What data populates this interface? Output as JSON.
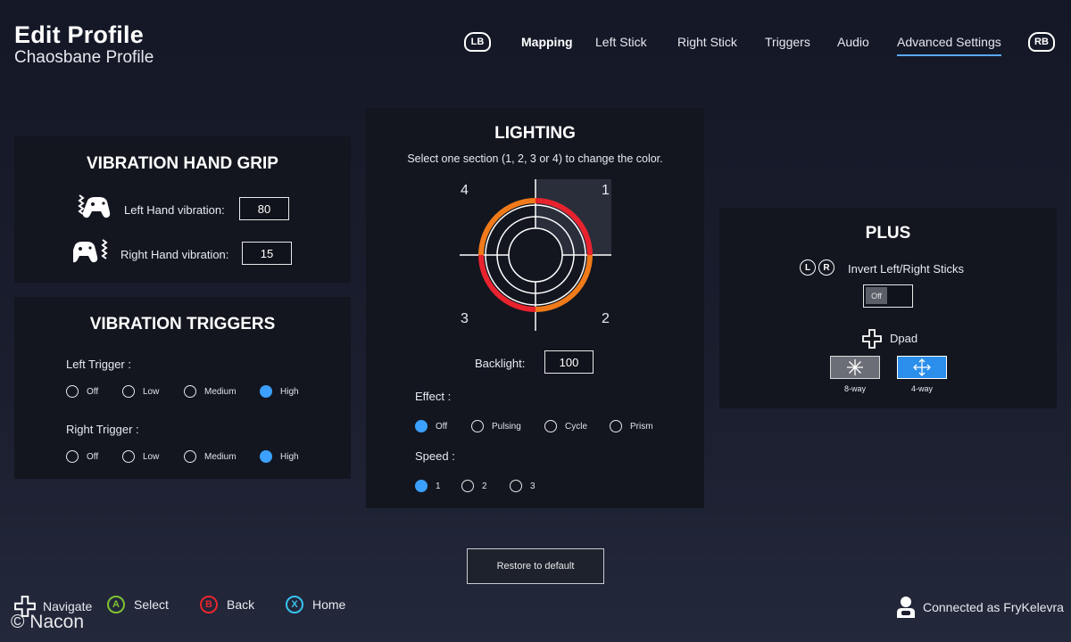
{
  "header": {
    "title": "Edit Profile",
    "subtitle": "Chaosbane Profile"
  },
  "nav": {
    "lb": "LB",
    "rb": "RB",
    "tabs": [
      "Mapping",
      "Left Stick",
      "Right Stick",
      "Triggers",
      "Audio",
      "Advanced Settings"
    ],
    "active_tab": "Advanced Settings"
  },
  "vibration_grip": {
    "title": "VIBRATION HAND GRIP",
    "left_label": "Left Hand vibration:",
    "left_value": "80",
    "right_label": "Right Hand vibration:",
    "right_value": "15"
  },
  "vibration_triggers": {
    "title": "VIBRATION TRIGGERS",
    "left_label": "Left Trigger :",
    "right_label": "Right Trigger :",
    "options": [
      "Off",
      "Low",
      "Medium",
      "High"
    ],
    "left_selected": "High",
    "right_selected": "High"
  },
  "lighting": {
    "title": "LIGHTING",
    "instruction": "Select one section (1, 2, 3 or 4) to change the color.",
    "quadrants": [
      "4",
      "1",
      "3",
      "2"
    ],
    "backlight_label": "Backlight:",
    "backlight_value": "100",
    "effect_label": "Effect :",
    "effects": [
      "Off",
      "Pulsing",
      "Cycle",
      "Prism"
    ],
    "effect_selected": "Off",
    "speed_label": "Speed :",
    "speeds": [
      "1",
      "2",
      "3"
    ],
    "speed_selected": "1",
    "colors": {
      "red": "#e8232e",
      "orange": "#f07a1a"
    }
  },
  "plus": {
    "title": "PLUS",
    "invert_l": "L",
    "invert_r": "R",
    "invert_label": "Invert Left/Right Sticks",
    "toggle_value": "Off",
    "dpad_label": "Dpad",
    "dpad_8way": "8-way",
    "dpad_4way": "4-way"
  },
  "restore_label": "Restore to default",
  "footer": {
    "navigate": "Navigate",
    "a": "A",
    "select": "Select",
    "b": "B",
    "back": "Back",
    "x": "X",
    "home": "Home",
    "connected": "Connected as FryKelevra",
    "watermark": "© Nacon",
    "colors": {
      "a": "#7ec234",
      "b": "#e8262d",
      "x": "#38c3ee",
      "accent": "#3ba0ff"
    }
  }
}
